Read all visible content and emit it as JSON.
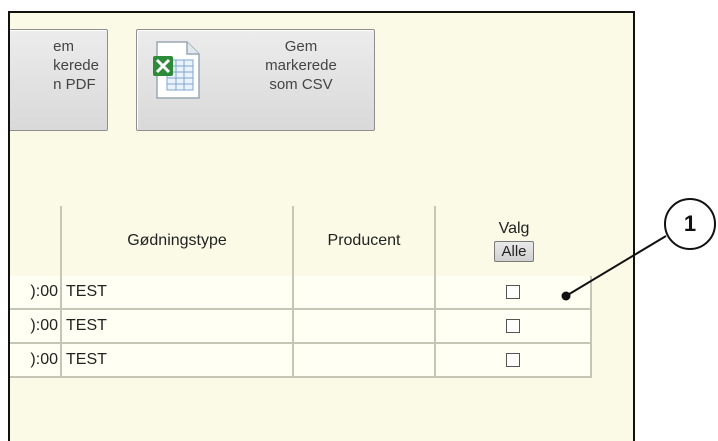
{
  "toolbar": {
    "pdf_button_lines": [
      "em",
      "kerede",
      "n PDF"
    ],
    "csv_button_lines": [
      "Gem",
      "markerede",
      "som CSV"
    ],
    "csv_icon": "excel-spreadsheet-icon"
  },
  "table": {
    "columns": {
      "godningstype": "Gødningstype",
      "producent": "Producent",
      "valg": "Valg",
      "alle": "Alle"
    },
    "rows": [
      {
        "time": "):00",
        "type": "TEST",
        "producent": "",
        "checked": false
      },
      {
        "time": "):00",
        "type": "TEST",
        "producent": "",
        "checked": false
      },
      {
        "time": "):00",
        "type": "TEST",
        "producent": "",
        "checked": false
      }
    ]
  },
  "callout": {
    "label": "1"
  }
}
